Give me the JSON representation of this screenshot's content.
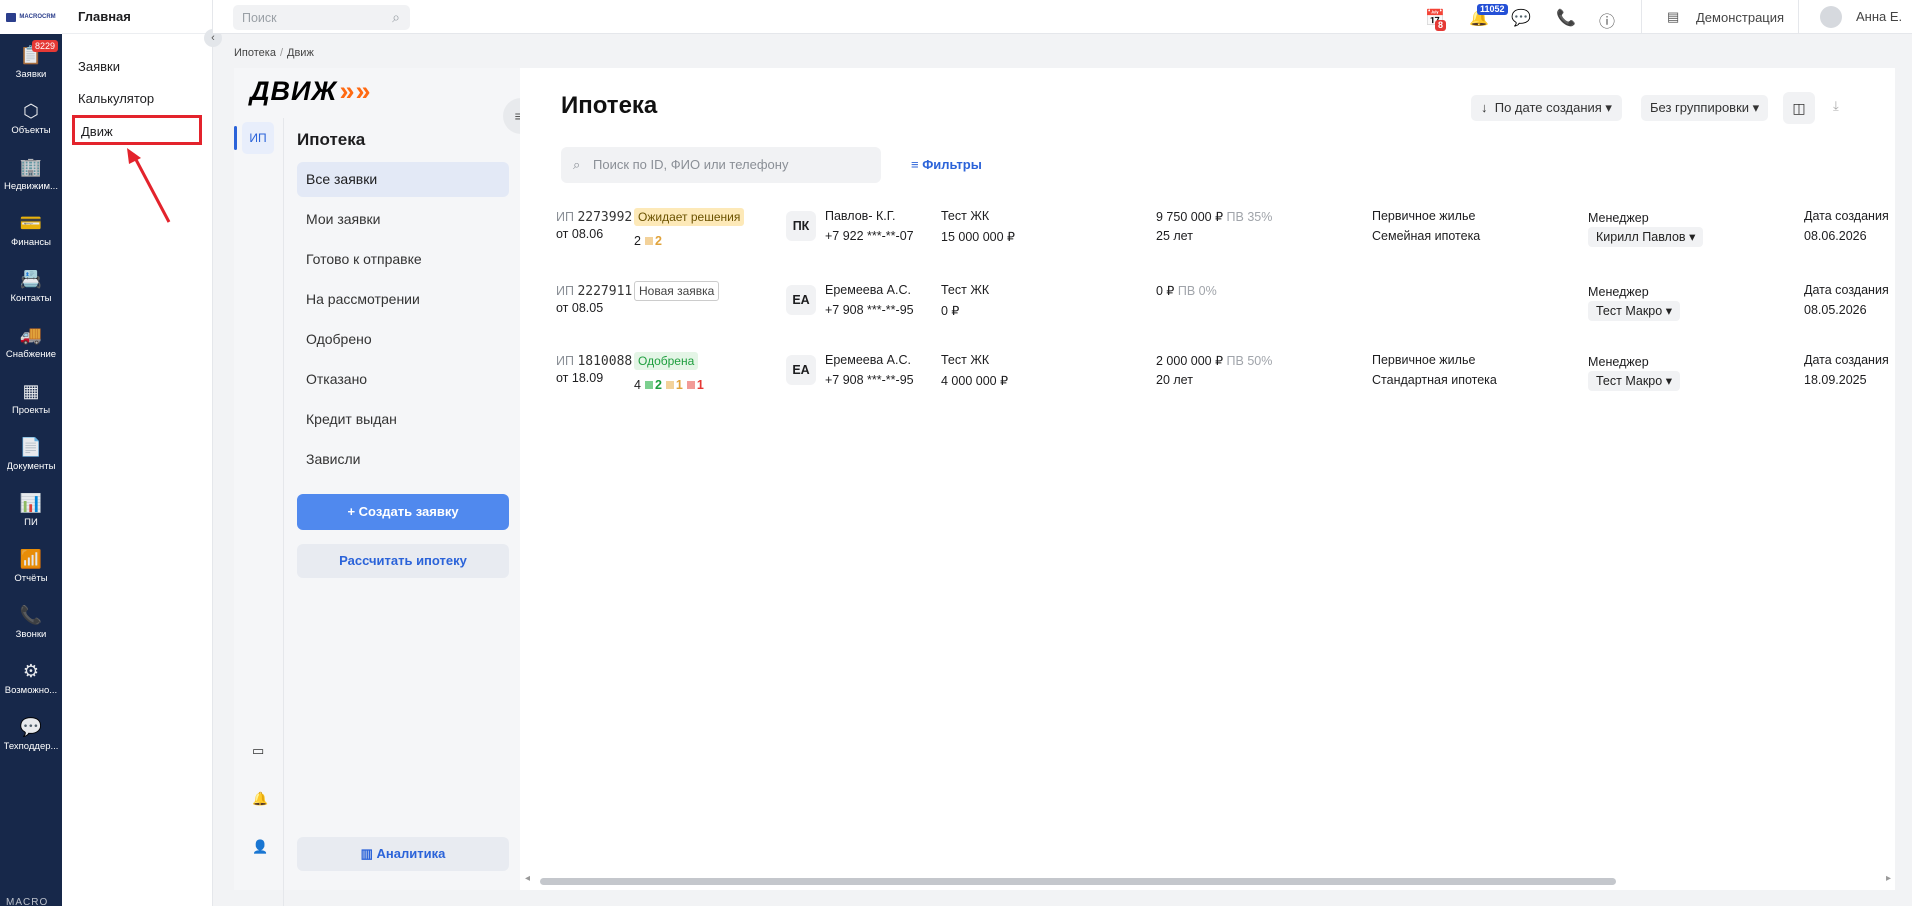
{
  "rail": {
    "logo_text": "MACROCRM",
    "items": [
      {
        "label": "Заявки",
        "badge": "8229",
        "icon": "📋"
      },
      {
        "label": "Объекты",
        "icon": "⬡"
      },
      {
        "label": "Недвижим...",
        "icon": "🏢"
      },
      {
        "label": "Финансы",
        "icon": "💳"
      },
      {
        "label": "Контакты",
        "icon": "📇"
      },
      {
        "label": "Снабжение",
        "icon": "🚚"
      },
      {
        "label": "Проекты",
        "icon": "▦"
      },
      {
        "label": "Документы",
        "icon": "📄"
      },
      {
        "label": "ПИ",
        "icon": "📊"
      },
      {
        "label": "Отчёты",
        "icon": "📶"
      },
      {
        "label": "Звонки",
        "icon": "📞"
      },
      {
        "label": "Возможно...",
        "icon": "⚙"
      },
      {
        "label": "Техподдер...",
        "icon": "💬"
      }
    ],
    "bottom_text": "MACRO"
  },
  "submenu": {
    "title": "Главная",
    "items": [
      "Заявки",
      "Калькулятор",
      "Движ"
    ]
  },
  "topbar": {
    "search_placeholder": "Поиск",
    "calendar_badge": "8",
    "notif_badge": "11052",
    "company": "Демонстрация",
    "user": "Анна Е."
  },
  "breadcrumbs": [
    "Ипотека",
    "Движ"
  ],
  "module": {
    "brand": "ДВИЖ",
    "brand_chevrons": "»»",
    "tab": "ИП",
    "title": "Ипотека",
    "items": [
      "Все заявки",
      "Мои заявки",
      "Готово к отправке",
      "На рассмотрении",
      "Одобрено",
      "Отказано",
      "Кредит выдан",
      "Зависли"
    ],
    "create_btn": "Создать заявку",
    "calc_btn": "Рассчитать ипотеку",
    "analytics_btn": "Аналитика"
  },
  "main": {
    "title": "Ипотека",
    "sort_label": "По дате создания",
    "group_label": "Без группировки",
    "search_placeholder": "Поиск по ID, ФИО или телефону",
    "filters_label": "Фильтры",
    "rows": [
      {
        "id_prefix": "ИП",
        "id": "2273992",
        "date": "от 08.06",
        "status": "Ожидает решения",
        "counts": {
          "total": "2",
          "orange": "2"
        },
        "initials": "ПК",
        "name": "Павлов- К.Г.",
        "phone": "+7 922 ***-**-07",
        "complex": "Тест ЖК",
        "price": "15 000 000 ₽",
        "loan": "9 750 000 ₽",
        "pv": "ПВ 35%",
        "term": "25 лет",
        "housing": "Первичное жилье",
        "program": "Семейная ипотека",
        "manager_label": "Менеджер",
        "manager": "Кирилл Павлов",
        "created_label": "Дата создания",
        "created": "08.06.2026"
      },
      {
        "id_prefix": "ИП",
        "id": "2227911",
        "date": "от 08.05",
        "status": "Новая заявка",
        "initials": "ЕА",
        "name": "Еремеева А.С.",
        "phone": "+7 908 ***-**-95",
        "complex": "Тест ЖК",
        "price": "0 ₽",
        "loan": "0 ₽",
        "pv": "ПВ 0%",
        "manager_label": "Менеджер",
        "manager": "Тест Макро",
        "created_label": "Дата создания",
        "created": "08.05.2026"
      },
      {
        "id_prefix": "ИП",
        "id": "1810088",
        "date": "от 18.09",
        "status": "Одобрена",
        "counts": {
          "total": "4",
          "green": "2",
          "orange": "1",
          "red": "1"
        },
        "initials": "ЕА",
        "name": "Еремеева А.С.",
        "phone": "+7 908 ***-**-95",
        "complex": "Тест ЖК",
        "price": "4 000 000 ₽",
        "loan": "2 000 000 ₽",
        "pv": "ПВ 50%",
        "term": "20 лет",
        "housing": "Первичное жилье",
        "program": "Стандартная ипотека",
        "manager_label": "Менеджер",
        "manager": "Тест Макро",
        "created_label": "Дата создания",
        "created": "18.09.2025"
      }
    ]
  },
  "colors": {
    "rail": "#17284a",
    "accent": "#5089ee",
    "highlight": "#e3232c",
    "brand_orange": "#ff6a13"
  }
}
